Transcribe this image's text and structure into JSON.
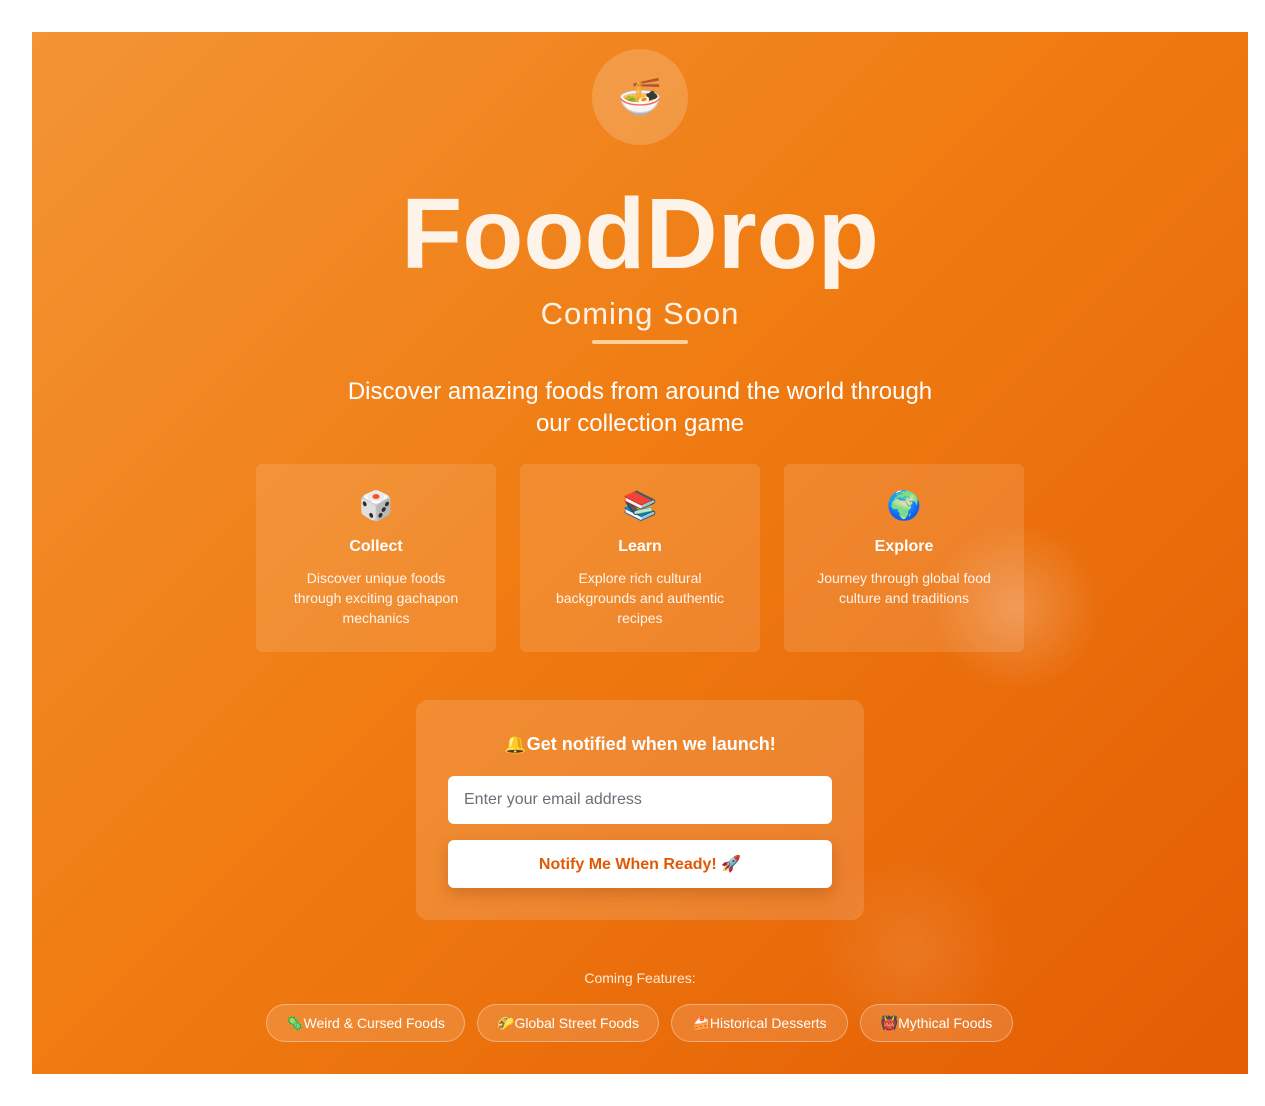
{
  "logo": {
    "icon": "🍜",
    "icon_name": "noodle-bowl-icon"
  },
  "title": "FoodDrop",
  "subtitle": "Coming Soon",
  "tagline_line1": "Discover amazing foods from around the world through",
  "tagline_line2": "our collection game",
  "cards": [
    {
      "icon": "🎲",
      "icon_name": "dice-icon",
      "title": "Collect",
      "text": "Discover unique foods through exciting gachapon mechanics"
    },
    {
      "icon": "📚",
      "icon_name": "books-icon",
      "title": "Learn",
      "text": "Explore rich cultural backgrounds and authentic recipes"
    },
    {
      "icon": "🌍",
      "icon_name": "globe-icon",
      "title": "Explore",
      "text": "Journey through global food culture and traditions"
    }
  ],
  "notify": {
    "heading": "🔔Get notified when we launch!",
    "email_placeholder": "Enter your email address",
    "email_value": "",
    "button_label": "Notify Me When Ready! 🚀"
  },
  "features": {
    "label": "Coming Features:",
    "tags": [
      "🦠Weird & Cursed Foods",
      "🌮Global Street Foods",
      "🍰Historical Desserts",
      "👹Mythical Foods"
    ]
  },
  "colors": {
    "accent": "#f07c12",
    "button_text": "#e05a05"
  }
}
